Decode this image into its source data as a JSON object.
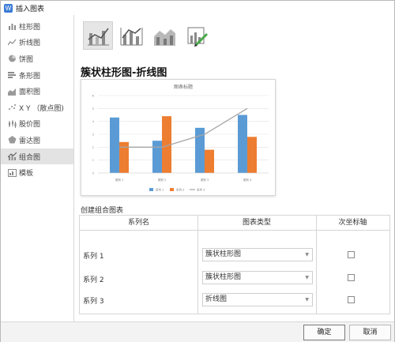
{
  "window": {
    "title": "插入图表",
    "app_icon": "W"
  },
  "sidebar": {
    "items": [
      {
        "label": "柱形图",
        "icon": "column-chart-icon"
      },
      {
        "label": "折线图",
        "icon": "line-chart-icon"
      },
      {
        "label": "饼图",
        "icon": "pie-chart-icon"
      },
      {
        "label": "条形图",
        "icon": "bar-chart-icon"
      },
      {
        "label": "面积图",
        "icon": "area-chart-icon"
      },
      {
        "label": "X Y （散点图)",
        "icon": "scatter-chart-icon"
      },
      {
        "label": "股价图",
        "icon": "stock-chart-icon"
      },
      {
        "label": "雷达图",
        "icon": "radar-chart-icon"
      },
      {
        "label": "组合图",
        "icon": "combo-chart-icon",
        "active": true
      },
      {
        "label": "模板",
        "icon": "template-icon"
      }
    ]
  },
  "section_title": "簇状柱形图-折线图",
  "chart_data": {
    "type": "bar",
    "title": "图表标题",
    "categories": [
      "类别 1",
      "类别 2",
      "类别 3",
      "类别 4"
    ],
    "ylim": [
      0,
      6
    ],
    "yticks": [
      "0",
      "1",
      "2",
      "3",
      "4",
      "5",
      "6"
    ],
    "series": [
      {
        "name": "系列 1",
        "kind": "bar",
        "color": "#5b9bd5",
        "values": [
          4.3,
          2.5,
          3.5,
          4.5
        ]
      },
      {
        "name": "系列 2",
        "kind": "bar",
        "color": "#ed7d31",
        "values": [
          2.4,
          4.4,
          1.8,
          2.8
        ]
      },
      {
        "name": "系列 3",
        "kind": "line",
        "color": "#a5a5a5",
        "values": [
          2,
          2,
          3,
          5
        ]
      }
    ],
    "grid": true,
    "legend": "bottom"
  },
  "combo": {
    "subtitle": "创建组合图表",
    "headers": {
      "name": "系列名",
      "type": "图表类型",
      "axis": "次坐标轴"
    },
    "rows": [
      {
        "name": "系列 1",
        "type": "簇状柱形图",
        "secondary": false
      },
      {
        "name": "系列 2",
        "type": "簇状柱形图",
        "secondary": false
      },
      {
        "name": "系列 3",
        "type": "折线图",
        "secondary": false
      }
    ]
  },
  "buttons": {
    "ok": "确定",
    "cancel": "取消"
  }
}
